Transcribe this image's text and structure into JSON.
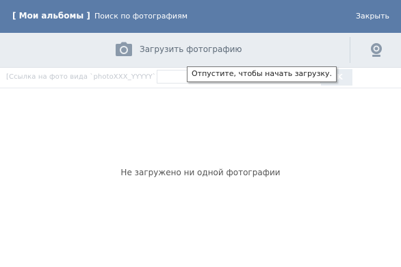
{
  "header": {
    "my_albums": "[ Мои альбомы ]",
    "search": "Поиск по фотографиям",
    "close": "Закрыть"
  },
  "upload": {
    "label": "Загрузить фотографию",
    "icon": "camera-icon",
    "webcam_icon": "webcam-icon"
  },
  "link_row": {
    "hint": "[Ссылка на фото вида `photoXXX_YYYYY`]:",
    "input_value": "",
    "ok_label": "OK"
  },
  "tooltip": "Отпустите, чтобы начать загрузку.",
  "empty_text": "Не загружено ни одной фотографии",
  "colors": {
    "header_bg": "#5b7ca8",
    "upload_bar_bg": "#e9edf1",
    "icon": "#8a99aa"
  }
}
